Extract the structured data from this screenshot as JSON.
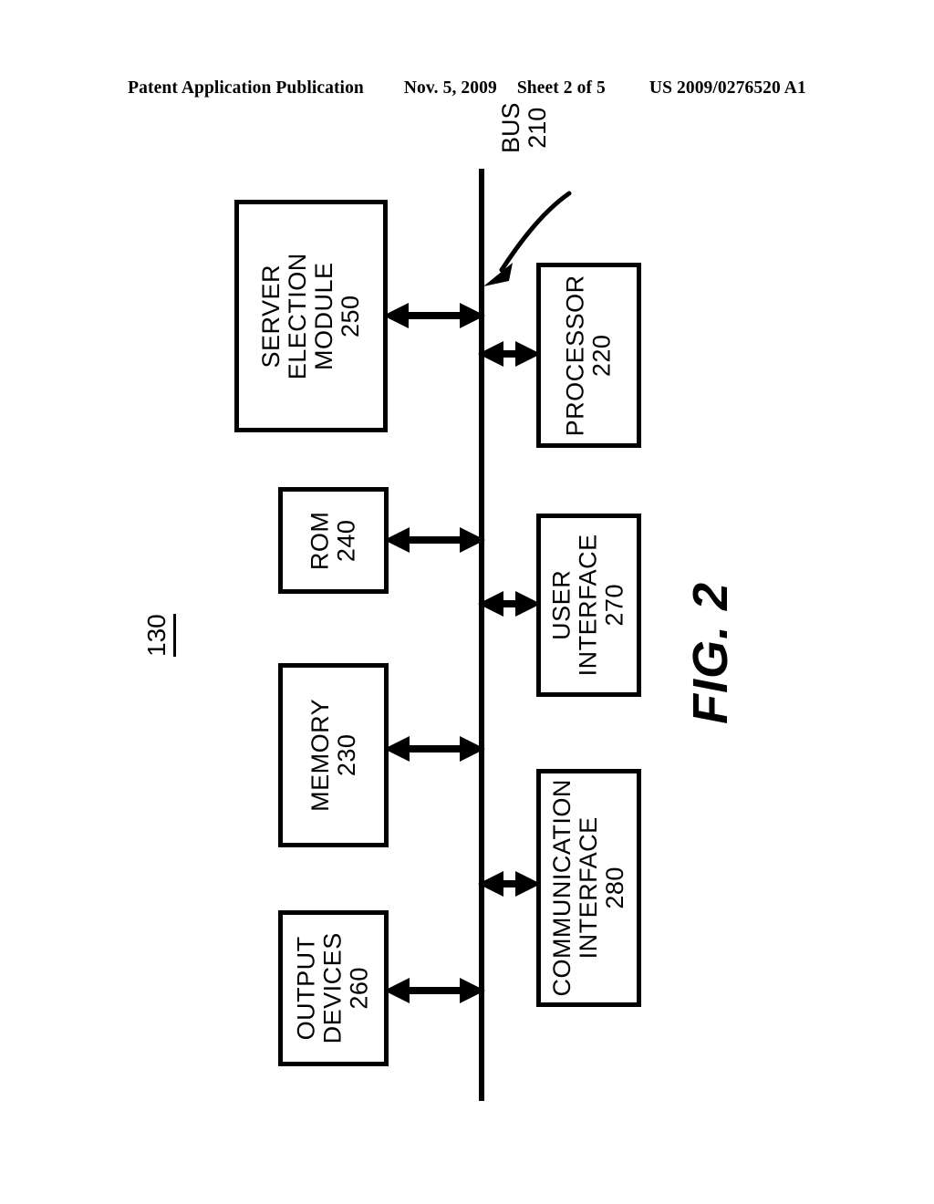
{
  "header": {
    "publication": "Patent Application Publication",
    "date": "Nov. 5, 2009",
    "sheet": "Sheet 2 of 5",
    "document_number": "US 2009/0276520 A1"
  },
  "figure": {
    "caption": "FIG. 2",
    "reference_numeral": "130",
    "bus": {
      "label": "BUS",
      "numeral": "210"
    },
    "blocks": [
      {
        "id": "server-election-module",
        "label": "SERVER\nELECTION\nMODULE",
        "line1": "SERVER",
        "line2": "ELECTION",
        "line3": "MODULE",
        "numeral": "250",
        "side": "left"
      },
      {
        "id": "rom",
        "label": "ROM",
        "line1": "ROM",
        "numeral": "240",
        "side": "left"
      },
      {
        "id": "memory",
        "label": "MEMORY",
        "line1": "MEMORY",
        "numeral": "230",
        "side": "left"
      },
      {
        "id": "output-devices",
        "label": "OUTPUT DEVICES",
        "line1": "OUTPUT",
        "line2": "DEVICES",
        "numeral": "260",
        "side": "left"
      },
      {
        "id": "processor",
        "label": "PROCESSOR",
        "line1": "PROCESSOR",
        "numeral": "220",
        "side": "right"
      },
      {
        "id": "user-interface",
        "label": "USER INTERFACE",
        "line1": "USER",
        "line2": "INTERFACE",
        "numeral": "270",
        "side": "right"
      },
      {
        "id": "communication-interface",
        "label": "COMMUNICATION INTERFACE",
        "line1": "COMMUNICATION",
        "line2": "INTERFACE",
        "numeral": "280",
        "side": "right"
      }
    ],
    "connectors": [
      {
        "id": "server-election-module-to-bus",
        "type": "double-arrow"
      },
      {
        "id": "rom-to-bus",
        "type": "double-arrow"
      },
      {
        "id": "memory-to-bus",
        "type": "double-arrow"
      },
      {
        "id": "output-devices-to-bus",
        "type": "double-arrow"
      },
      {
        "id": "bus-to-processor",
        "type": "double-arrow"
      },
      {
        "id": "bus-to-user-interface",
        "type": "double-arrow"
      },
      {
        "id": "bus-to-communication-interface",
        "type": "double-arrow"
      }
    ]
  },
  "colors": {
    "ink": "#000000",
    "paper": "#ffffff"
  }
}
